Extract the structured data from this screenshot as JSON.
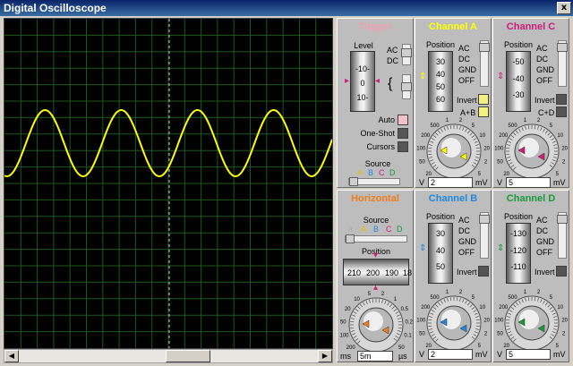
{
  "window": {
    "title": "Digital Oscilloscope",
    "close": "x"
  },
  "colors": {
    "chA": "#ffff00",
    "chB": "#2288dd",
    "chC": "#d01c7c",
    "chD": "#1a9a3a",
    "horizontal": "#f07d1e",
    "trigger": "#f0a0b0",
    "grid": "#1a5a1a",
    "trace": "#ffff00"
  },
  "trigger": {
    "title": "Trigger",
    "level_label": "Level",
    "level_ticks": [
      "-10-",
      "0",
      "10-"
    ],
    "ac": "AC",
    "dc": "DC",
    "auto": "Auto",
    "one_shot": "One-Shot",
    "cursors": "Cursors",
    "source_label": "Source",
    "sources": [
      "A",
      "B",
      "C",
      "D"
    ]
  },
  "channel_a": {
    "title": "Channel A",
    "position_label": "Position",
    "drum": [
      "30",
      "40",
      "50",
      "60"
    ],
    "modes": [
      "AC",
      "DC",
      "GND",
      "OFF"
    ],
    "invert": "Invert",
    "sum": "A+B",
    "dial_values": [
      "20",
      "50",
      "100",
      "200",
      "500",
      "1",
      "2",
      "5",
      "10",
      "20",
      "2",
      "5",
      "0.5",
      "0.2",
      "0.1"
    ],
    "unit_v": "V",
    "value": "2",
    "unit": "mV"
  },
  "channel_b": {
    "title": "Channel B",
    "position_label": "Position",
    "drum": [
      "30",
      "40",
      "50"
    ],
    "modes": [
      "AC",
      "DC",
      "GND",
      "OFF"
    ],
    "invert": "Invert",
    "dial_values": [
      "20",
      "50",
      "100",
      "200",
      "500",
      "1",
      "2",
      "5",
      "10",
      "20",
      "2",
      "5",
      "0.5",
      "0.2",
      "0.1"
    ],
    "unit_v": "V",
    "value": "2",
    "unit": "mV"
  },
  "channel_c": {
    "title": "Channel C",
    "position_label": "Position",
    "drum": [
      "-50",
      "-40",
      "-30"
    ],
    "modes": [
      "AC",
      "DC",
      "GND",
      "OFF"
    ],
    "invert": "Invert",
    "sum": "C+D",
    "dial_values": [
      "20",
      "50",
      "100",
      "200",
      "500",
      "1",
      "2",
      "5",
      "10",
      "20",
      "2",
      "5",
      "0.5",
      "0.2",
      "0.1"
    ],
    "unit_v": "V",
    "value": "5",
    "unit": "mV"
  },
  "channel_d": {
    "title": "Channel D",
    "position_label": "Position",
    "drum": [
      "-130",
      "-120",
      "-110"
    ],
    "modes": [
      "AC",
      "DC",
      "GND",
      "OFF"
    ],
    "invert": "Invert",
    "dial_values": [
      "20",
      "50",
      "100",
      "200",
      "500",
      "1",
      "2",
      "5",
      "10",
      "20",
      "2",
      "5",
      "0.5",
      "0.2",
      "0.1"
    ],
    "unit_v": "V",
    "value": "5",
    "unit": "mV"
  },
  "horizontal": {
    "title": "Horizontal",
    "source_label": "Source",
    "sources": [
      "A",
      "B",
      "C",
      "D"
    ],
    "position_label": "Position",
    "scale": [
      "210",
      "200",
      "190",
      "18"
    ],
    "dial_values": [
      "200",
      "100",
      "50",
      "20",
      "10",
      "5",
      "2",
      "1",
      "0.5",
      "0.2",
      "0.1",
      "50",
      "20",
      "10",
      "5",
      "2",
      "1",
      "0.5"
    ],
    "unit_ms": "ms",
    "value": "5m",
    "unit": "µs"
  }
}
